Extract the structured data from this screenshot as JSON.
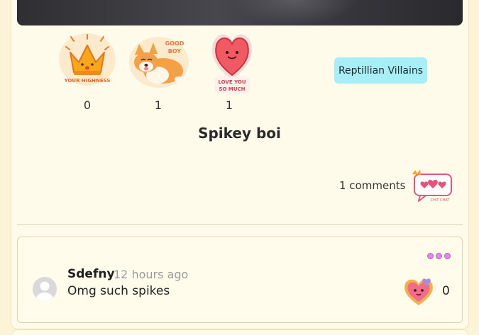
{
  "stickers": [
    {
      "name": "crown",
      "caption": "YOUR HIGHNESS",
      "count": "0"
    },
    {
      "name": "corgi",
      "caption": "GOOD BOY",
      "count": "1"
    },
    {
      "name": "heart",
      "caption": "LOVE YOU SO MUCH",
      "count": "1"
    }
  ],
  "tag": {
    "label": "Reptillian Villains"
  },
  "post": {
    "title": "Spikey boi"
  },
  "comments": {
    "label": "1 comments",
    "chat_caption": "CHIT CHAT"
  },
  "comment": {
    "author": "Sdefny",
    "time": "12 hours ago",
    "text": "Omg such spikes",
    "reactions": "0"
  },
  "colors": {
    "background": "#fdf3d7",
    "card": "#fffbea",
    "tag": "#a8eef6",
    "accent_pink": "#e08ae4"
  },
  "icons": [
    "crown-sticker-icon",
    "corgi-sticker-icon",
    "heart-sticker-icon",
    "chat-bubble-icon",
    "more-dots-icon",
    "heart-cookie-icon",
    "avatar-icon"
  ]
}
